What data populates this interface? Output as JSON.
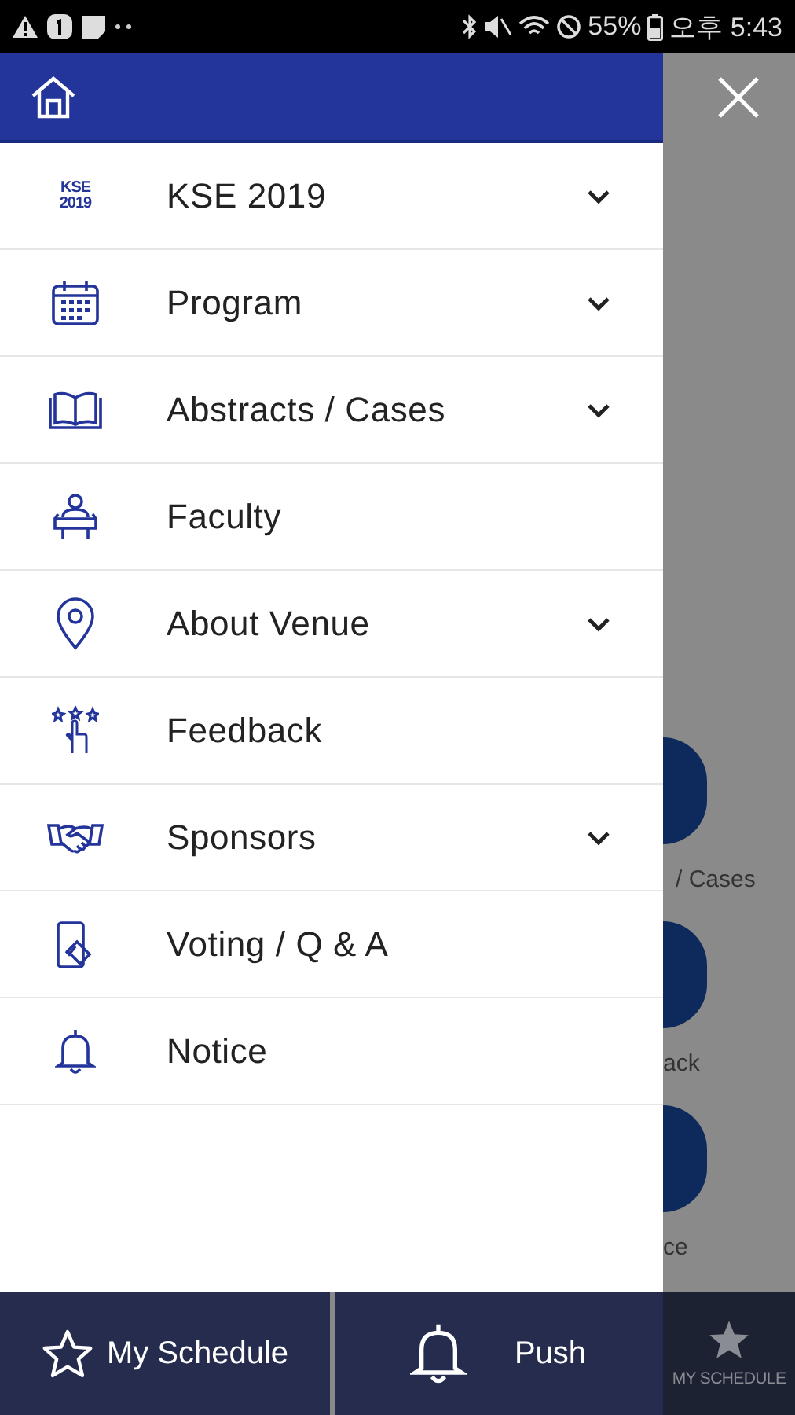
{
  "status_bar": {
    "battery": "55%",
    "time": "오후 5:43"
  },
  "drawer": {
    "menu": [
      {
        "label": "KSE 2019",
        "logo_text": [
          "KSE",
          "2019"
        ],
        "expandable": true
      },
      {
        "label": "Program",
        "expandable": true
      },
      {
        "label": "Abstracts / Cases",
        "expandable": true
      },
      {
        "label": "Faculty",
        "expandable": false
      },
      {
        "label": "About Venue",
        "expandable": true
      },
      {
        "label": "Feedback",
        "expandable": false
      },
      {
        "label": "Sponsors",
        "expandable": true
      },
      {
        "label": "Voting / Q & A",
        "expandable": false
      },
      {
        "label": "Notice",
        "expandable": false
      }
    ],
    "footer": [
      {
        "label": "My Schedule"
      },
      {
        "label": "Push"
      }
    ]
  },
  "background": {
    "tiles": [
      "/ Cases",
      "ack",
      "ce"
    ],
    "tab": "MY SCHEDULE"
  }
}
